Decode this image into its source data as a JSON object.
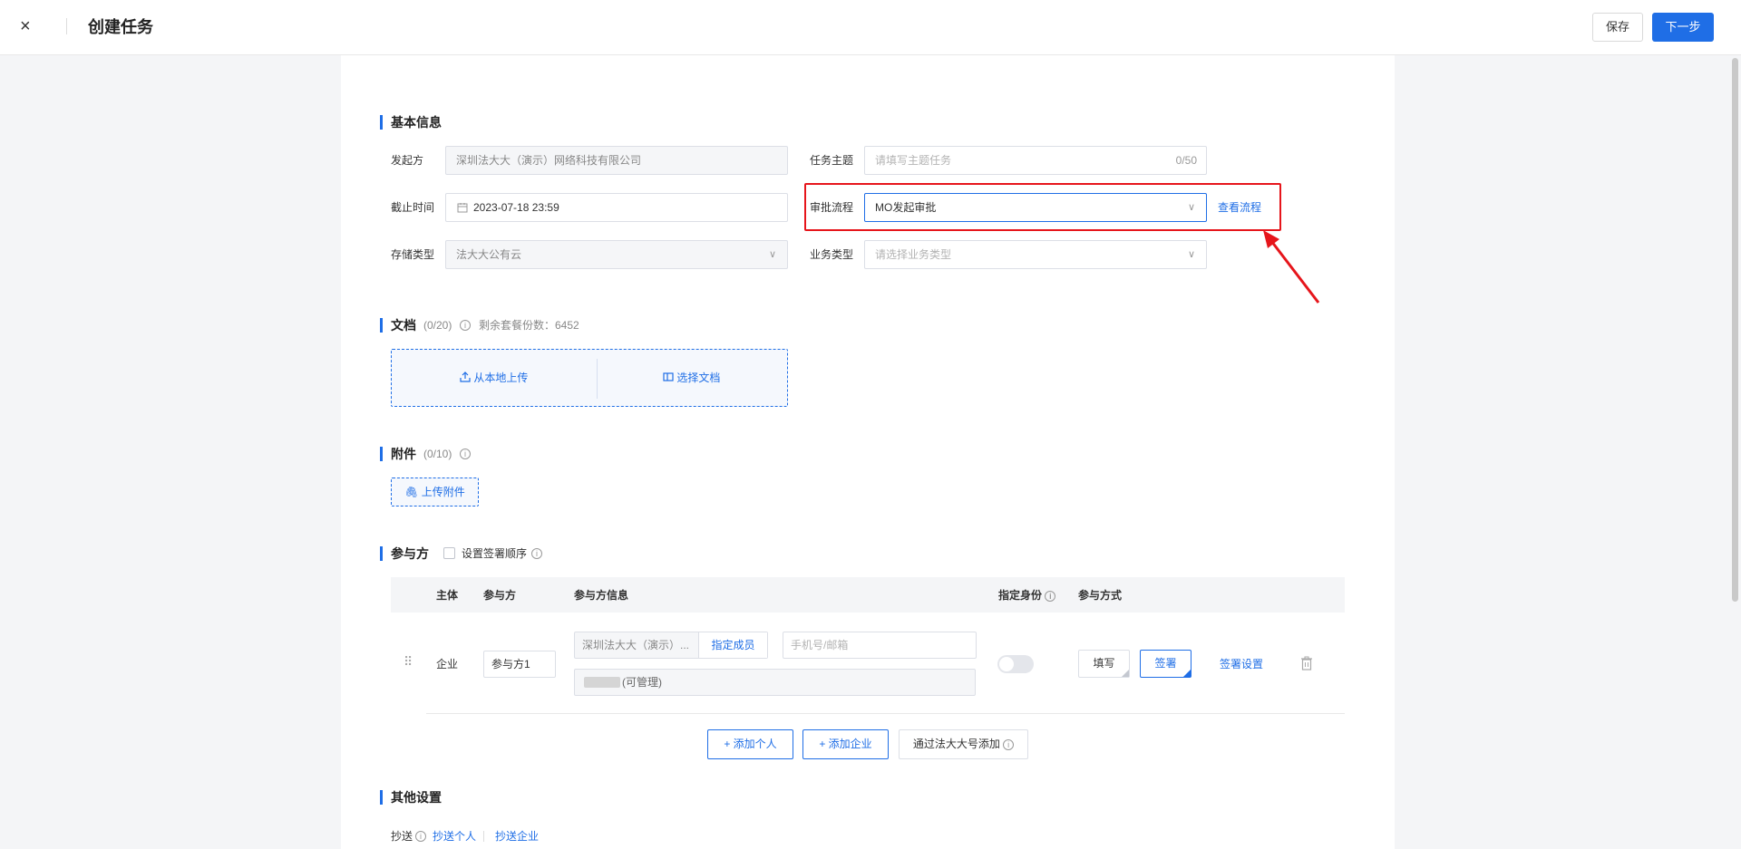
{
  "header": {
    "close_icon": "×",
    "title": "创建任务",
    "save_label": "保存",
    "next_label": "下一步"
  },
  "basic": {
    "title": "基本信息",
    "initiator_label": "发起方",
    "initiator_value": "深圳法大大（演示）网络科技有限公司",
    "subject_label": "任务主题",
    "subject_placeholder": "请填写主题任务",
    "subject_count": "0/50",
    "deadline_label": "截止时间",
    "deadline_value": "2023-07-18 23:59",
    "approval_label": "审批流程",
    "approval_value": "MO发起审批",
    "view_flow_link": "查看流程",
    "storage_label": "存储类型",
    "storage_value": "法大大公有云",
    "biz_label": "业务类型",
    "biz_placeholder": "请选择业务类型"
  },
  "docs": {
    "title": "文档",
    "count": "(0/20)",
    "remaining": "剩余套餐份数：6452",
    "upload_local": "从本地上传",
    "choose_doc": "选择文档"
  },
  "attach": {
    "title": "附件",
    "count": "(0/10)",
    "upload_label": "上传附件"
  },
  "parties": {
    "title": "参与方",
    "order_label": "设置签署顺序",
    "headers": {
      "subject": "主体",
      "party": "参与方",
      "info": "参与方信息",
      "identity": "指定身份",
      "mode": "参与方式"
    },
    "row": {
      "type": "企业",
      "name": "参与方1",
      "company": "深圳法大大（演示）...",
      "pick_member": "指定成员",
      "contact_placeholder": "手机号/邮箱",
      "admin": "(可管理)",
      "fill": "填写",
      "sign": "签署",
      "sign_settings": "签署设置"
    },
    "add_person": "+ 添加个人",
    "add_company": "+ 添加企业",
    "add_by_account": "通过法大大号添加"
  },
  "other": {
    "title": "其他设置",
    "cc_label": "抄送",
    "cc_person": "抄送个人",
    "cc_company": "抄送企业"
  }
}
